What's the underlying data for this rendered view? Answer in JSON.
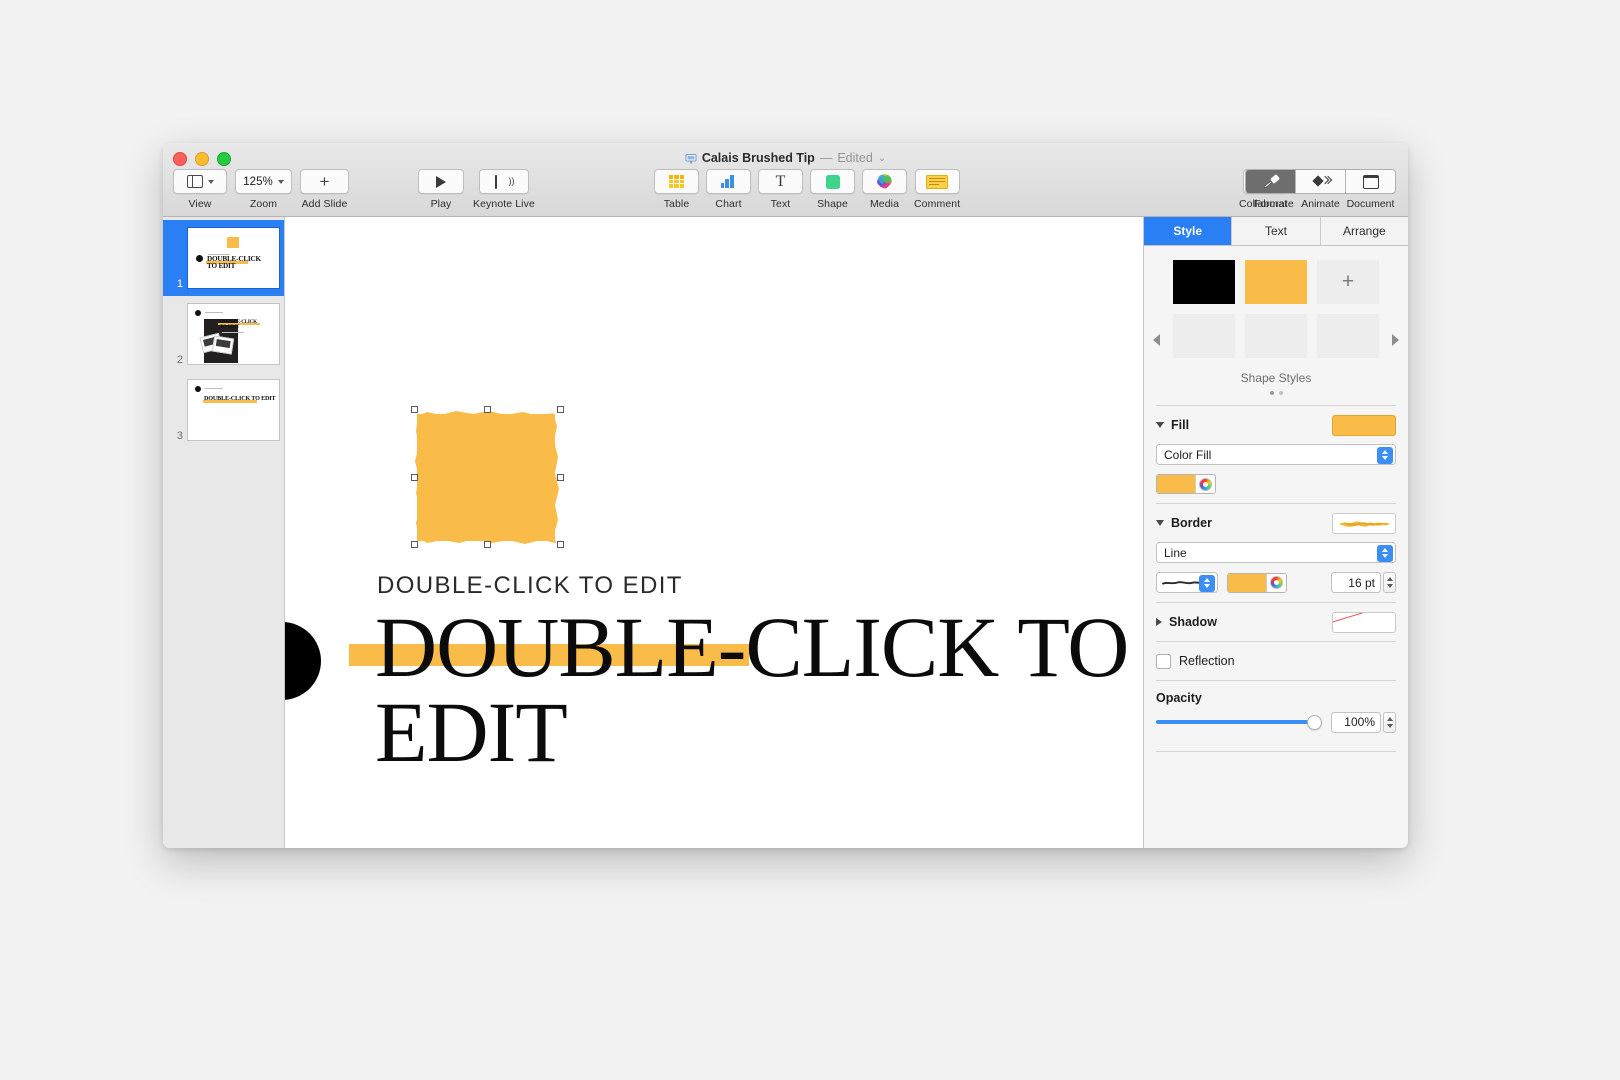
{
  "window": {
    "title_name": "Calais Brushed Tip",
    "title_sep": "—",
    "title_status": "Edited",
    "title_chevron": "⌄",
    "app_icon": "keynote-icon"
  },
  "toolbar": {
    "left": [
      {
        "label": "View",
        "icon": "sidebar-layout-icon",
        "has_chevron": true
      },
      {
        "label": "Zoom",
        "value": "125%",
        "icon": "zoom-value",
        "has_chevron": true
      },
      {
        "label": "Add Slide",
        "icon": "plus-icon"
      }
    ],
    "play": [
      {
        "label": "Play",
        "icon": "play-triangle-icon"
      },
      {
        "label": "Keynote Live",
        "icon": "broadcast-screen-icon"
      }
    ],
    "insert": [
      {
        "label": "Table",
        "icon": "table-icon"
      },
      {
        "label": "Chart",
        "icon": "bar-chart-icon"
      },
      {
        "label": "Text",
        "icon": "text-t-icon"
      },
      {
        "label": "Shape",
        "icon": "green-square-icon"
      },
      {
        "label": "Media",
        "icon": "photos-flower-icon"
      },
      {
        "label": "Comment",
        "icon": "comment-note-icon"
      }
    ],
    "collaborate": {
      "label": "Collaborate",
      "icon": "add-person-icon"
    },
    "right_segment": [
      {
        "label": "Format",
        "icon": "paintbrush-icon",
        "active": true
      },
      {
        "label": "Animate",
        "icon": "diamond-motion-icon",
        "active": false
      },
      {
        "label": "Document",
        "icon": "document-icon",
        "active": false
      }
    ]
  },
  "navigator": {
    "slides": [
      {
        "number": "1",
        "selected": true,
        "kind": "title-with-square"
      },
      {
        "number": "2",
        "selected": false,
        "kind": "photo-collage"
      },
      {
        "number": "3",
        "selected": false,
        "kind": "headline-only"
      }
    ]
  },
  "canvas": {
    "subtitle": "DOUBLE-CLICK TO EDIT",
    "headline": "DOUBLE-CLICK TO EDIT",
    "shape": {
      "name": "brushed-square",
      "fill_color": "#fabc48",
      "selected": true,
      "handle_count": 8
    },
    "accent_bar_color": "#fabc48",
    "circle_color": "#000000"
  },
  "inspector": {
    "tabs": [
      {
        "label": "Style",
        "active": true
      },
      {
        "label": "Text",
        "active": false
      },
      {
        "label": "Arrange",
        "active": false
      }
    ],
    "shape_styles": {
      "caption": "Shape Styles",
      "swatches": [
        "#000000",
        "#fabc48",
        "add",
        "empty",
        "empty",
        "empty"
      ],
      "add_label": "+",
      "page_dots": 2,
      "active_dot": 1
    },
    "fill": {
      "title": "Fill",
      "expanded": true,
      "type_value": "Color Fill",
      "color": "#fabc48"
    },
    "border": {
      "title": "Border",
      "expanded": true,
      "type_value": "Line",
      "color": "#fabc48",
      "width_value": "16 pt",
      "style_icon": "brush-stroke-icon"
    },
    "shadow": {
      "title": "Shadow",
      "expanded": false,
      "preview": "none"
    },
    "reflection": {
      "label": "Reflection",
      "checked": false
    },
    "opacity": {
      "label": "Opacity",
      "value": "100%",
      "percent": 100
    }
  }
}
